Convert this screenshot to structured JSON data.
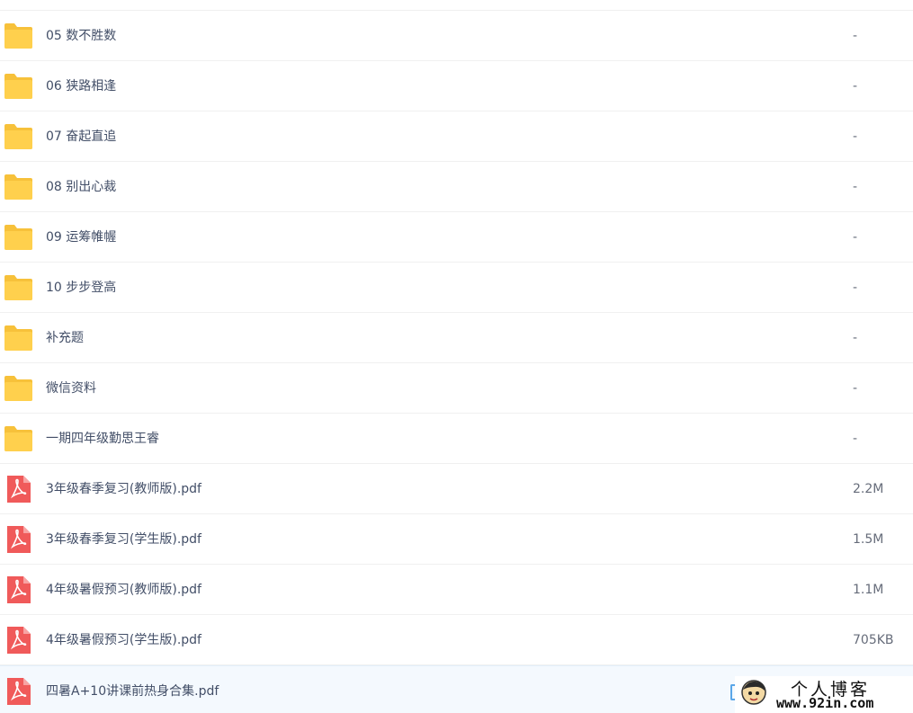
{
  "files": [
    {
      "name": "05 数不胜数",
      "size": "-",
      "type": "folder"
    },
    {
      "name": "06 狭路相逢",
      "size": "-",
      "type": "folder"
    },
    {
      "name": "07 奋起直追",
      "size": "-",
      "type": "folder"
    },
    {
      "name": "08 别出心裁",
      "size": "-",
      "type": "folder"
    },
    {
      "name": "09 运筹帷幄",
      "size": "-",
      "type": "folder"
    },
    {
      "name": "10 步步登高",
      "size": "-",
      "type": "folder"
    },
    {
      "name": "补充题",
      "size": "-",
      "type": "folder"
    },
    {
      "name": "微信资料",
      "size": "-",
      "type": "folder"
    },
    {
      "name": "一期四年级勤思王睿",
      "size": "-",
      "type": "folder"
    },
    {
      "name": "3年级春季复习(教师版).pdf",
      "size": "2.2M",
      "type": "pdf"
    },
    {
      "name": "3年级春季复习(学生版).pdf",
      "size": "1.5M",
      "type": "pdf"
    },
    {
      "name": "4年级暑假预习(教师版).pdf",
      "size": "1.1M",
      "type": "pdf"
    },
    {
      "name": "4年级暑假预习(学生版).pdf",
      "size": "705KB",
      "type": "pdf"
    },
    {
      "name": "四暑A+10讲课前热身合集.pdf",
      "size": "",
      "type": "pdf"
    }
  ],
  "icons": {
    "folder": "folder-icon",
    "pdf": "pdf-icon"
  },
  "colors": {
    "folder": "#ffd04d",
    "folder_tab": "#f7c13a",
    "pdf": "#f05a5a",
    "text": "#424e67",
    "highlight_row": "#f4f9fe"
  },
  "watermark": {
    "title": "个人博客",
    "url": "www.92in.com"
  }
}
